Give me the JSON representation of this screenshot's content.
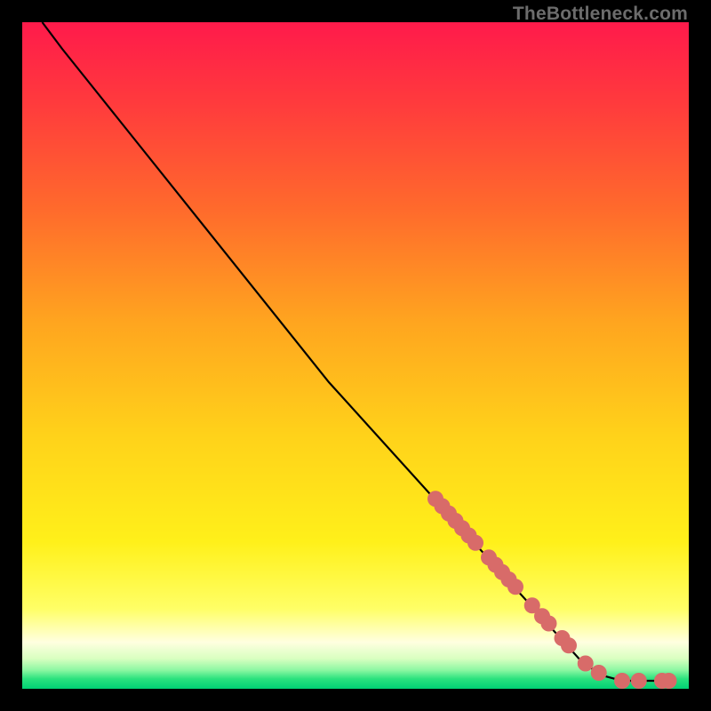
{
  "watermark": "TheBottleneck.com",
  "colors": {
    "frame": "#000000",
    "line": "#000000",
    "marker_fill": "#d86b69",
    "marker_stroke": "#d86b69",
    "gradient_stops": [
      {
        "offset": 0.0,
        "color": "#ff1a4b"
      },
      {
        "offset": 0.12,
        "color": "#ff3a3d"
      },
      {
        "offset": 0.28,
        "color": "#ff6a2c"
      },
      {
        "offset": 0.45,
        "color": "#ffa51f"
      },
      {
        "offset": 0.62,
        "color": "#ffd21a"
      },
      {
        "offset": 0.78,
        "color": "#fff01a"
      },
      {
        "offset": 0.88,
        "color": "#ffff66"
      },
      {
        "offset": 0.93,
        "color": "#ffffe0"
      },
      {
        "offset": 0.955,
        "color": "#d8ffc0"
      },
      {
        "offset": 0.972,
        "color": "#8cf7a2"
      },
      {
        "offset": 0.985,
        "color": "#2be27e"
      },
      {
        "offset": 1.0,
        "color": "#00d074"
      }
    ]
  },
  "chart_data": {
    "type": "line",
    "xlabel": "",
    "ylabel": "",
    "xlim": [
      0,
      100
    ],
    "ylim": [
      0,
      100
    ],
    "title": "",
    "line_points": [
      {
        "x": 3,
        "y": 100
      },
      {
        "x": 6,
        "y": 96
      },
      {
        "x": 10,
        "y": 91
      },
      {
        "x": 14,
        "y": 86
      },
      {
        "x": 46,
        "y": 46
      },
      {
        "x": 84,
        "y": 4
      },
      {
        "x": 87,
        "y": 2
      },
      {
        "x": 90,
        "y": 1.2
      },
      {
        "x": 97,
        "y": 1.2
      }
    ],
    "markers": [
      {
        "x": 62.0,
        "y": 28.5
      },
      {
        "x": 63.0,
        "y": 27.4
      },
      {
        "x": 64.0,
        "y": 26.3
      },
      {
        "x": 65.0,
        "y": 25.2
      },
      {
        "x": 66.0,
        "y": 24.1
      },
      {
        "x": 67.0,
        "y": 23.0
      },
      {
        "x": 68.0,
        "y": 21.9
      },
      {
        "x": 70.0,
        "y": 19.7
      },
      {
        "x": 71.0,
        "y": 18.6
      },
      {
        "x": 72.0,
        "y": 17.5
      },
      {
        "x": 73.0,
        "y": 16.4
      },
      {
        "x": 74.0,
        "y": 15.3
      },
      {
        "x": 76.5,
        "y": 12.5
      },
      {
        "x": 78.0,
        "y": 10.9
      },
      {
        "x": 79.0,
        "y": 9.8
      },
      {
        "x": 81.0,
        "y": 7.6
      },
      {
        "x": 82.0,
        "y": 6.5
      },
      {
        "x": 84.5,
        "y": 3.8
      },
      {
        "x": 86.5,
        "y": 2.4
      },
      {
        "x": 90.0,
        "y": 1.2
      },
      {
        "x": 92.5,
        "y": 1.2
      },
      {
        "x": 96.0,
        "y": 1.2
      },
      {
        "x": 97.0,
        "y": 1.2
      }
    ]
  }
}
